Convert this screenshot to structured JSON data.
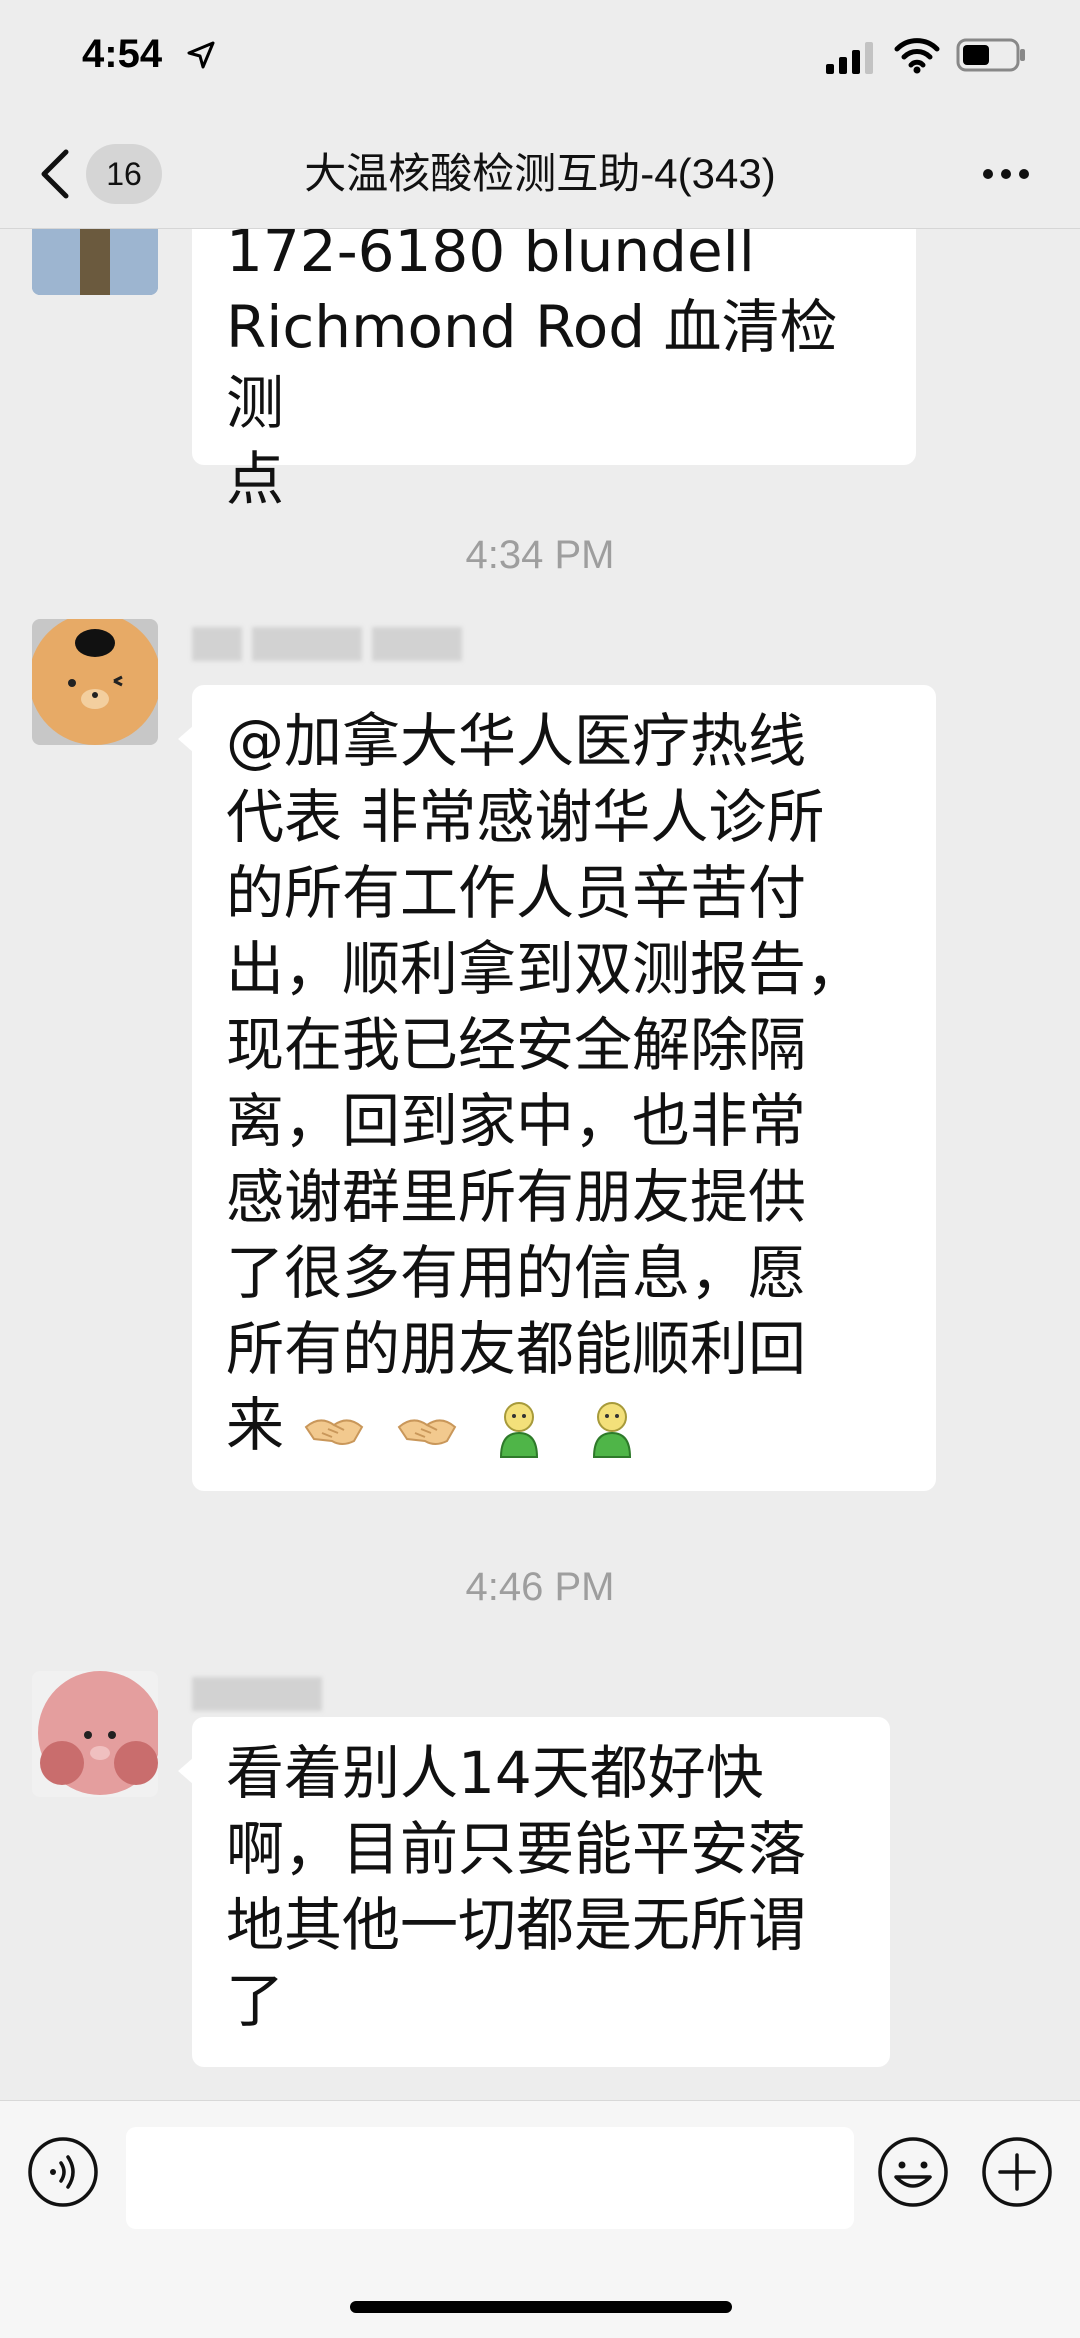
{
  "status_bar": {
    "time": "4:54",
    "icons": [
      "location-arrow-icon",
      "cellular-signal-icon",
      "wifi-icon",
      "battery-icon"
    ]
  },
  "nav": {
    "back_icon": "chevron-left-icon",
    "unread_count": "16",
    "title": "大温核酸检测互助-4(343)",
    "more_icon": "more-dots-icon"
  },
  "messages": [
    {
      "sender": "",
      "lines": [
        "172-6180 blundell",
        "Richmond Rod 血清检测",
        "点"
      ]
    },
    {
      "timestamp": "4:34 PM",
      "sender": "",
      "lines": [
        "@加拿大华人医疗热线",
        "代表 非常感谢华人诊所",
        "的所有工作人员辛苦付",
        "出，顺利拿到双测报告，",
        "现在我已经安全解除隔",
        "离，回到家中，也非常",
        "感谢群里所有朋友提供",
        "了很多有用的信息，愿",
        "所有的朋友都能顺利回",
        "来"
      ],
      "emojis": [
        "handshake-icon",
        "handshake-icon",
        "green-person-icon",
        "green-person-icon"
      ]
    },
    {
      "timestamp": "4:46 PM",
      "sender": "",
      "lines": [
        "看着别人14天都好快",
        "啊，目前只要能平安落",
        "地其他一切都是无所谓",
        "了"
      ]
    }
  ],
  "input_bar": {
    "voice_icon": "voice-icon",
    "placeholder": "",
    "emoji_icon": "smiley-icon",
    "plus_icon": "plus-circle-icon"
  },
  "colors": {
    "background": "#ededed",
    "bubble": "#ffffff",
    "timestamp": "#9e9e9e"
  }
}
